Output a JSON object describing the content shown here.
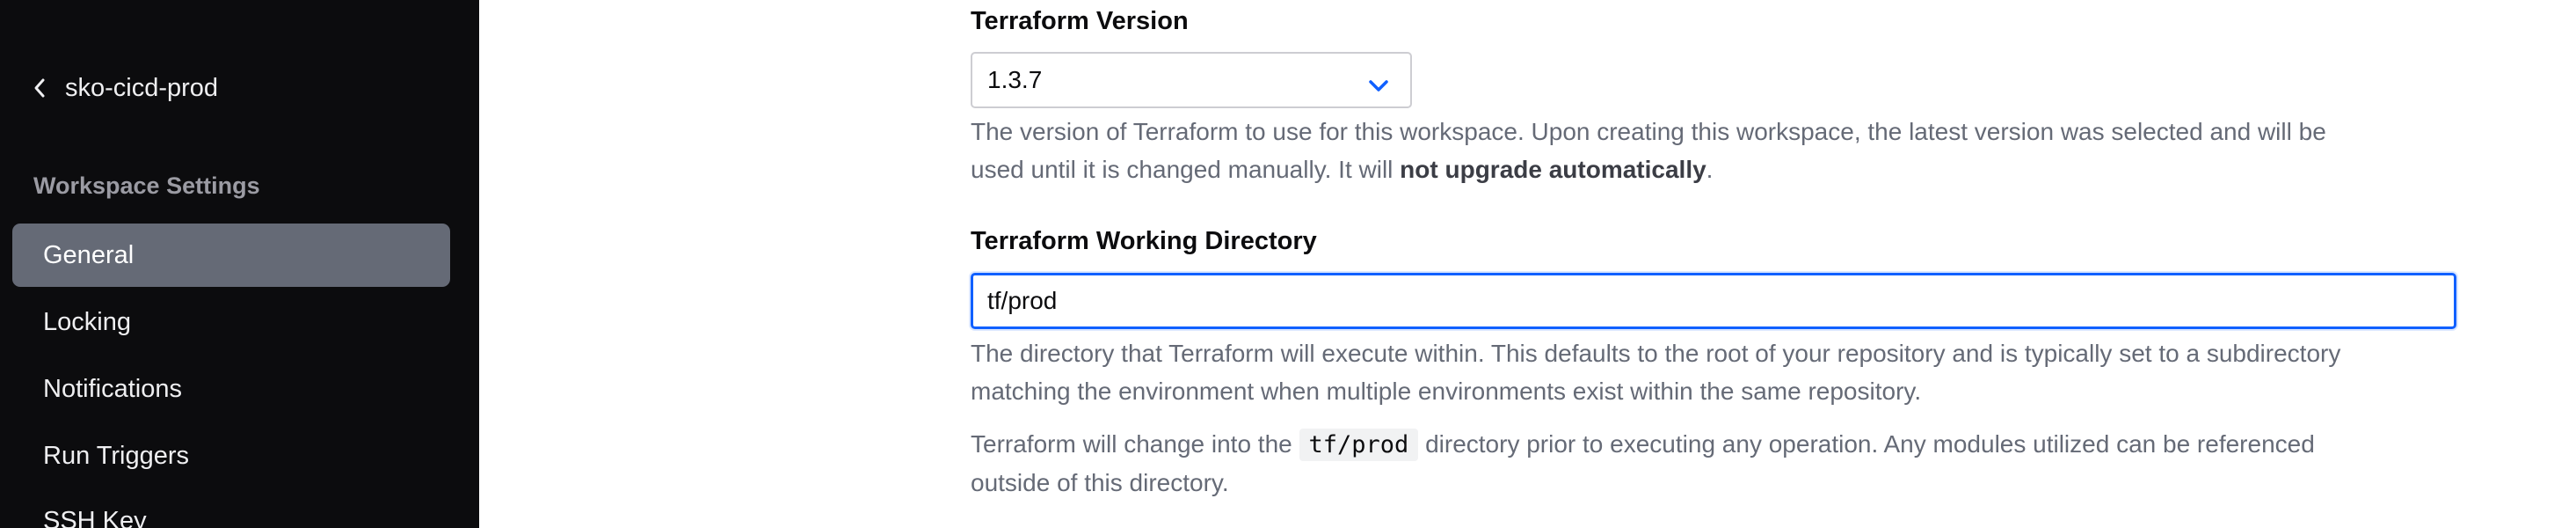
{
  "sidebar": {
    "back_label": "sko-cicd-prod",
    "section_title": "Workspace Settings",
    "items": [
      {
        "label": "General",
        "active": true
      },
      {
        "label": "Locking"
      },
      {
        "label": "Notifications"
      },
      {
        "label": "Run Triggers"
      },
      {
        "label": "SSH Key"
      }
    ]
  },
  "terraform_version": {
    "label": "Terraform Version",
    "selected": "1.3.7",
    "help_line1": "The version of Terraform to use for this workspace. Upon creating this workspace, the latest version was selected and will be",
    "help_line2_prefix": "used until it is changed manually. It will ",
    "help_line2_bold": "not upgrade automatically",
    "help_line2_suffix": "."
  },
  "working_directory": {
    "label": "Terraform Working Directory",
    "value": "tf/prod",
    "help1_line1": "The directory that Terraform will execute within. This defaults to the root of your repository and is typically set to a subdirectory",
    "help1_line2": "matching the environment when multiple environments exist within the same repository.",
    "help2_prefix": "Terraform will change into the ",
    "help2_code": "tf/prod",
    "help2_suffix": " directory prior to executing any operation. Any modules utilized can be referenced",
    "help2_line2": "outside of this directory."
  },
  "colors": {
    "sidebar_bg": "#0c0c0e",
    "active_item_bg": "#656a76",
    "focus_border": "#1060ff",
    "help_text": "#656a76"
  },
  "icons": {
    "back": "chevron-left-icon",
    "select": "chevron-down-icon"
  }
}
